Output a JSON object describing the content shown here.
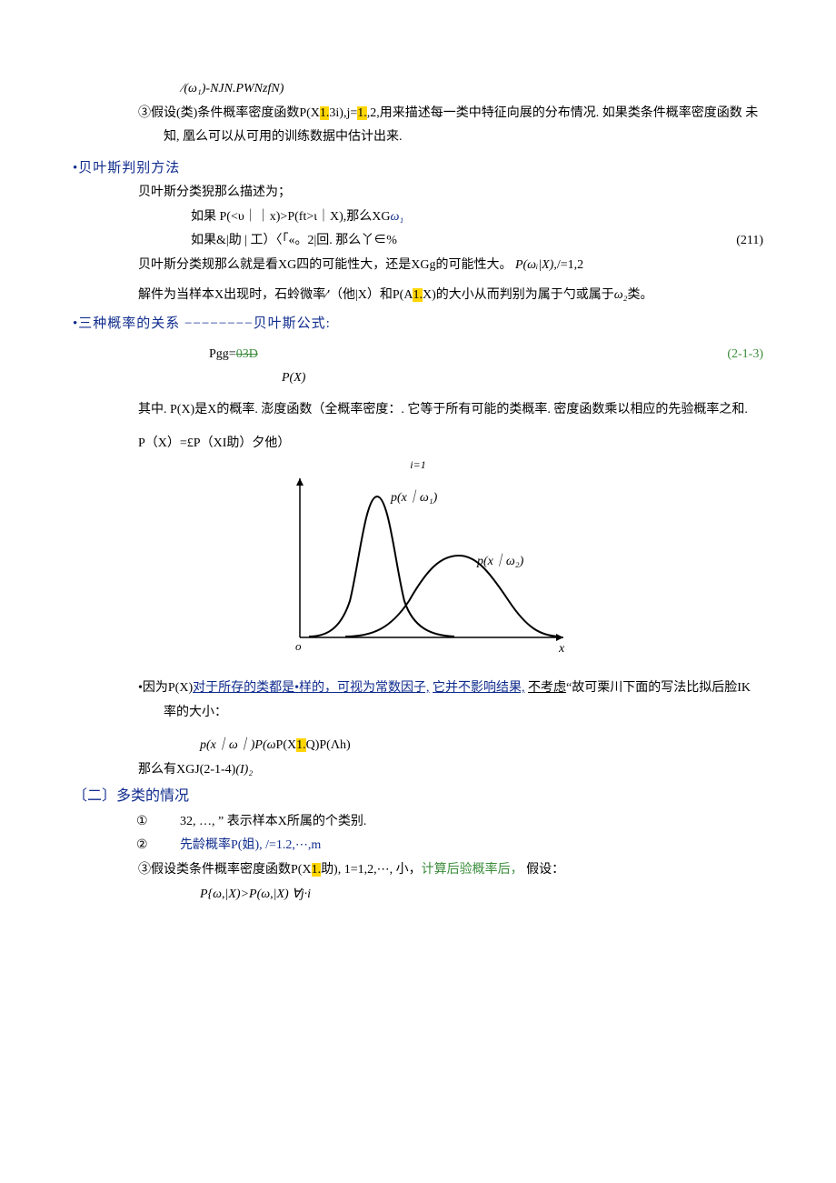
{
  "line1": "∕(ω₁)-NJN.PWNzfN)",
  "line2_pre": "③假设(类)条件概率密度函数P(X",
  "line2_hl1": "1.",
  "line2_mid": "3i),j=",
  "line2_hl2": "1.",
  "line2_post": ",2,用来描述每一类中特征向展的分布情况. 如果类条件概率密度函数",
  "line3": "未知, 凰么可以从可用的训练数据中估计出来.",
  "heading1": "•贝叶斯判别方法",
  "line4": "贝叶斯分类猊那么描述为；",
  "line5_txt": "如果 P(<υ｜｜x)>P(ft>ι｜X),那么XG",
  "line5_omega": "ω₁",
  "line6_left": "如果&|助 | 工）〈「«。2|回. 那么丫∈%",
  "line6_right": "(211)",
  "line7_pre": "贝叶斯分类规那么就是看XG四的可能性大，还是XGg的可能性大。",
  "line7_ital": "P(ωᵢ|X)",
  "line7_post": ",/=1,2",
  "line8_pre": "解件为当样本X出现时，石蛉微率∕'（他|X）和P(A",
  "line8_hl": "1.",
  "line8_post": "X)的大小从而判别为属于勺或属于",
  "line8_ital": "ω₂",
  "line8_end": "类。",
  "heading2": "•三种概率的关系 −−−−−−−−贝叶斯公式:",
  "line9_left_a": "Pgg=",
  "line9_left_b": "03D",
  "line9_right": "(2-1-3)",
  "line9b": "P(X)",
  "line10": "其中. P(X)是X的概率. 澎度函数（全概率密度：. 它等于所有可能的类概率. 密度函数乘以相应的先验概率之和.",
  "line11": "P（X）=£P（XI助）夕他）",
  "plot_title": "i=1",
  "plot_label1": "p(x｜ω₁)",
  "plot_label2": "p(x｜ω₂)",
  "plot_axis_o": "o",
  "plot_axis_x": "x",
  "line12_pre": "•因为P(X)",
  "line12_u1": "对于所存的类都是•样的，可视为常数因子,",
  "line12_u2": "它并不影响结果,",
  "line12_u3": "不考虑",
  "line12_post": "“故可栗川下面的写法比拟后脸IK率的大小：",
  "line13_ital": "p(x｜ω｜)P(ω",
  "line13_mid": "P(X",
  "line13_hl": "1.",
  "line13_post": "Q)P(Λh)",
  "line14_pre": "那么有XGJ(2-1-4)",
  "line14_ital": "(I)₂",
  "heading3": "〔二〕多类的情况",
  "li1_num": "①",
  "li1_txt": "32, …, ” 表示样本X所属的个类别.",
  "li2_num": "②",
  "li2_txt": "先龄概率P(姐), /=1.2,⋯,m",
  "li3_pre": "③假设类条件概率密度函数P(X",
  "li3_hl": "1.",
  "li3_mid": "助), 1=1,2,⋯, 小，",
  "li3_green": "计算后验概率后，",
  "li3_post": "假设：",
  "li4": "P{ω,|X)>P(ω,|X) ∀j·i",
  "chart_data": {
    "type": "line",
    "title": "i=1",
    "xlabel": "x",
    "ylabel": "",
    "x_origin_label": "o",
    "series": [
      {
        "name": "p(x|ω₁)",
        "x": [
          0.8,
          1.2,
          1.6,
          2.0,
          2.4,
          2.8,
          3.2,
          3.6,
          4.0
        ],
        "y": [
          0.02,
          0.1,
          0.44,
          0.9,
          0.45,
          0.12,
          0.04,
          0.02,
          0.01
        ]
      },
      {
        "name": "p(x|ω₂)",
        "x": [
          1.5,
          2.0,
          2.5,
          3.0,
          3.5,
          4.0,
          4.5,
          5.0,
          5.5,
          6.0,
          6.5
        ],
        "y": [
          0.01,
          0.04,
          0.14,
          0.32,
          0.46,
          0.43,
          0.31,
          0.18,
          0.09,
          0.04,
          0.02
        ]
      }
    ],
    "xlim": [
      0,
      7
    ],
    "ylim": [
      0,
      1.0
    ]
  }
}
